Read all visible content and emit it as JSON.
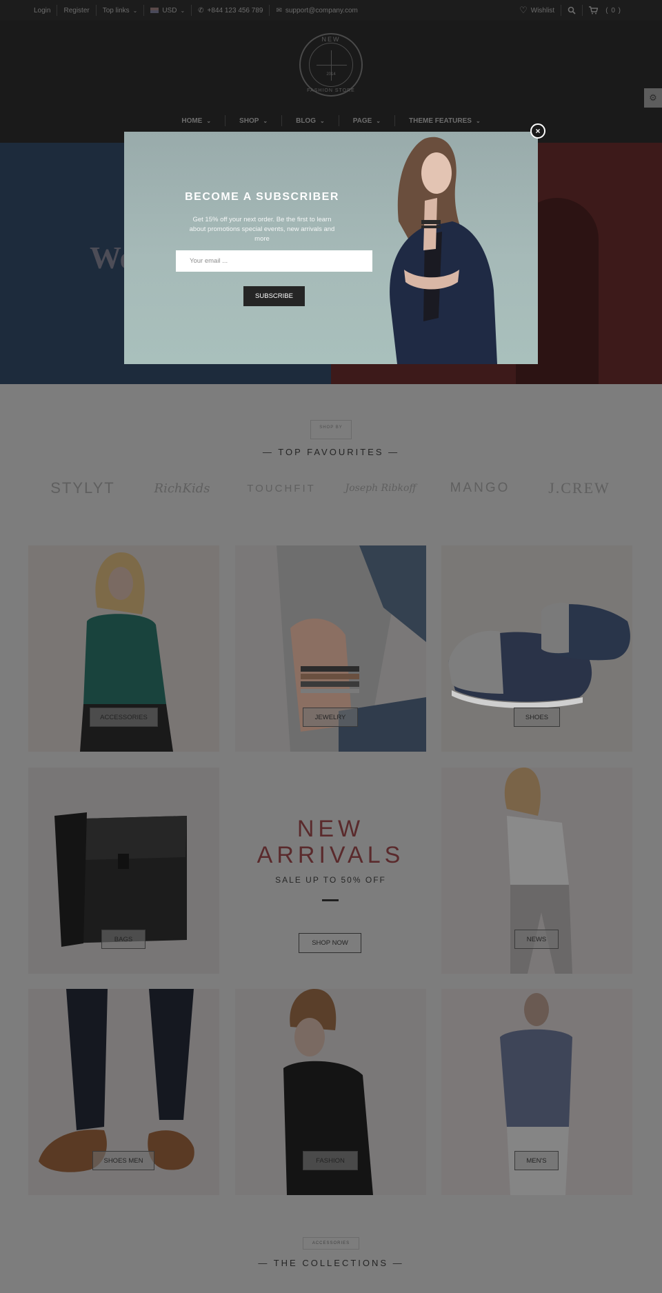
{
  "topbar": {
    "login": "Login",
    "register": "Register",
    "top_links": "Top links",
    "currency": "USD",
    "phone": "+844 123 456 789",
    "email": "support@company.com",
    "wishlist": "Wishlist",
    "cart_count": "( 0 )"
  },
  "logo": {
    "top_text": "NEW",
    "bottom_text": "FASHION STORE",
    "year": "2014",
    "letters": "P Y S"
  },
  "nav": {
    "items": [
      {
        "label": "HOME"
      },
      {
        "label": "SHOP"
      },
      {
        "label": "BLOG"
      },
      {
        "label": "PAGE"
      },
      {
        "label": "THEME FEATURES"
      }
    ]
  },
  "hero": {
    "word": "Wo"
  },
  "modal": {
    "title": "BECOME A SUBSCRIBER",
    "text": "Get 15% off your next order. Be the first to learn about promotions special events, new arrivals and more",
    "email_placeholder": "Your email ...",
    "subscribe_label": "SUBSCRIBE",
    "close_label": "×"
  },
  "favourites": {
    "shop_by": "SHOP BY",
    "title": "— TOP FAVOURITES —",
    "brands": [
      "STYLYT",
      "RichKids",
      "TOUCHFIT",
      "Joseph Ribkoff",
      "MANGO",
      "J.CREW"
    ]
  },
  "categories": {
    "accessories": "ACCESSORIES",
    "jewelry": "JEWELRY",
    "shoes": "SHOES",
    "bags": "BAGS",
    "news": "NEWS",
    "shoes_men": "SHOES MEN",
    "fashion": "FASHION",
    "mens": "MEN'S"
  },
  "arrivals": {
    "line1": "NEW",
    "line2": "ARRIVALS",
    "sale": "SALE UP TO 50% OFF",
    "button": "SHOP NOW"
  },
  "collections": {
    "badge": "ACCESSORIES",
    "title": "— THE COLLECTIONS —"
  },
  "colors": {
    "accent_red": "#5a2a2c",
    "overlay": "#7d7d7d",
    "header_bg": "#1a1a1a"
  }
}
